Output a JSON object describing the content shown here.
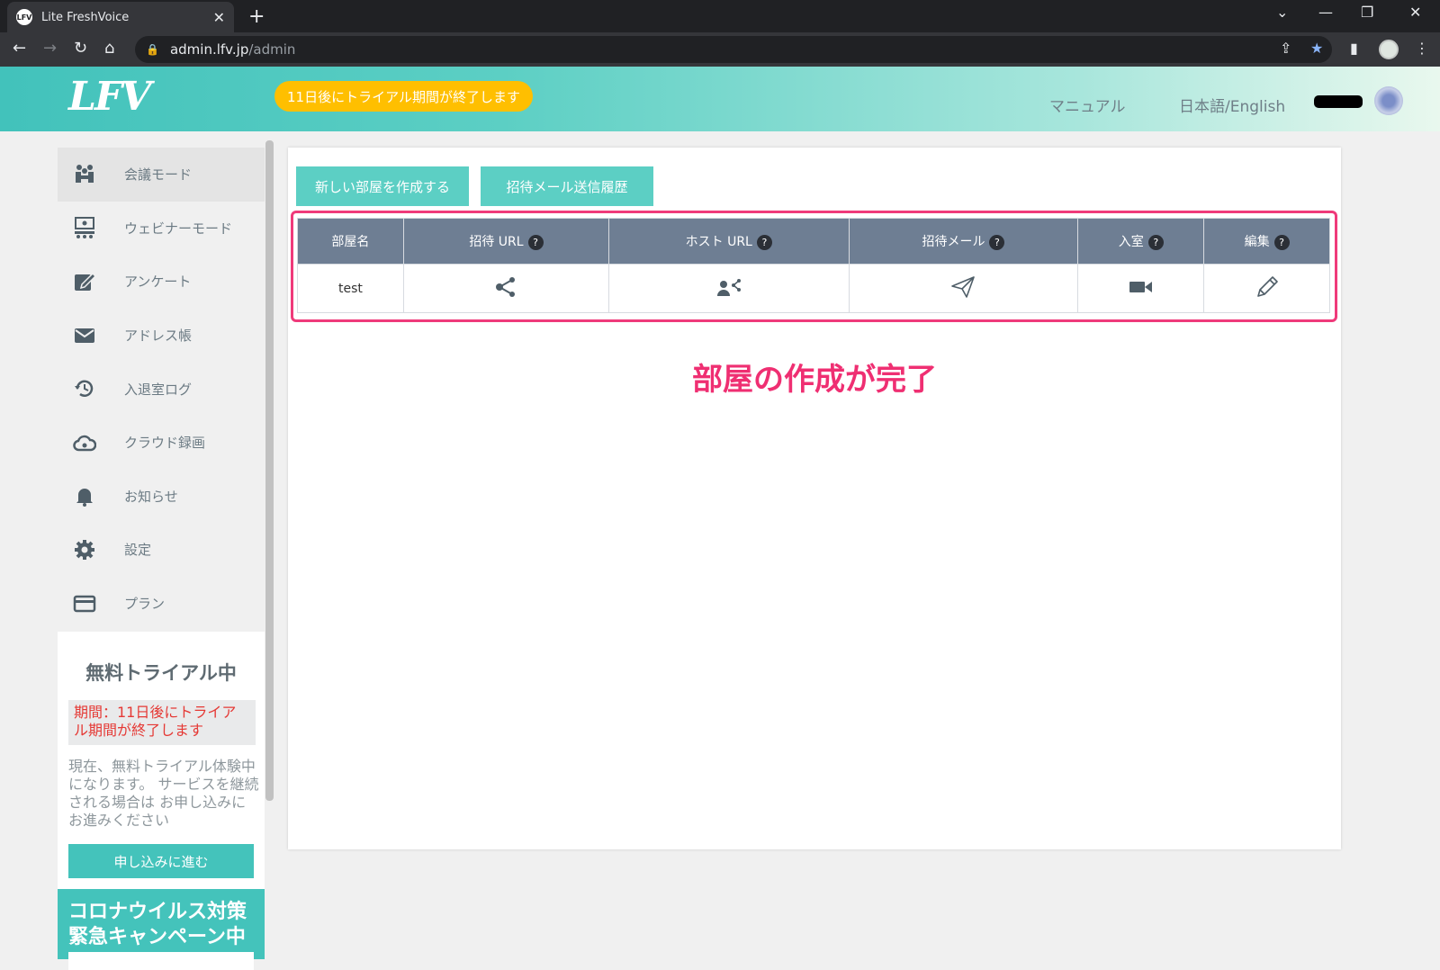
{
  "browser": {
    "tab_title": "Lite FreshVoice",
    "favicon_text": "LFV",
    "url_host": "admin.lfv.jp",
    "url_path": "/admin"
  },
  "header": {
    "logo_text": "LFV",
    "trial_notice": "11日後にトライアル期間が終了します",
    "manual_link": "マニュアル",
    "language_link": "日本語/English"
  },
  "sidebar": {
    "items": [
      {
        "label": "会議モード",
        "icon": "meeting-icon"
      },
      {
        "label": "ウェビナーモード",
        "icon": "webinar-icon"
      },
      {
        "label": "アンケート",
        "icon": "survey-icon"
      },
      {
        "label": "アドレス帳",
        "icon": "mail-icon"
      },
      {
        "label": "入退室ログ",
        "icon": "history-icon"
      },
      {
        "label": "クラウド録画",
        "icon": "cloud-icon"
      },
      {
        "label": "お知らせ",
        "icon": "bell-icon"
      },
      {
        "label": "設定",
        "icon": "gear-icon"
      },
      {
        "label": "プラン",
        "icon": "card-icon"
      }
    ],
    "trial": {
      "title": "無料トライアル中",
      "period": "期間：11日後にトライアル期間が終了します",
      "description": "現在、無料トライアル体験中 になります。 サービスを継続される場合は お申し込みにお進みください",
      "apply_button": "申し込みに進む"
    },
    "campaign": "コロナウイルス対策緊急キャンペーン中"
  },
  "main": {
    "new_room_button": "新しい部屋を作成する",
    "invite_history_button": "招待メール送信履歴",
    "table": {
      "headers": [
        "部屋名",
        "招待 URL",
        "ホスト URL",
        "招待メール",
        "入室",
        "編集"
      ],
      "rows": [
        {
          "room_name": "test"
        }
      ]
    },
    "completion_message": "部屋の作成が完了"
  },
  "colors": {
    "accent": "#44c3bb",
    "table_header": "#6e7e93",
    "highlight": "#ef3a7a",
    "trial_pill": "#ffbf00"
  }
}
